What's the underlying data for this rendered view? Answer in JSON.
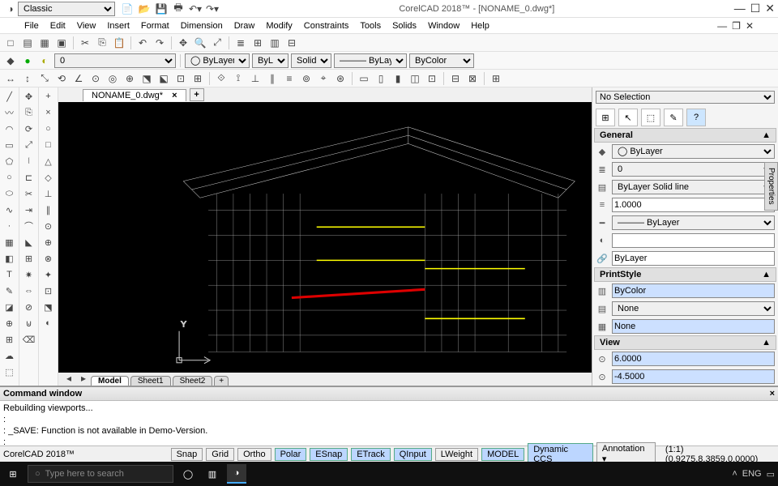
{
  "title": "CorelCAD 2018™ - [NONAME_0.dwg*]",
  "workspace": "Classic",
  "menus": [
    "File",
    "Edit",
    "View",
    "Insert",
    "Format",
    "Dimension",
    "Draw",
    "Modify",
    "Constraints",
    "Tools",
    "Solids",
    "Window",
    "Help"
  ],
  "doc_tab": "NONAME_0.dwg*",
  "view_tabs": [
    "Model",
    "Sheet1",
    "Sheet2"
  ],
  "layer_combo1": "◯ ByLayer",
  "layer_combo2": "ByLayer",
  "linetype": "Solid line",
  "layer_line": "ByLayer",
  "bycolor": "ByColor",
  "zero": "0",
  "no_selection": "No Selection",
  "sections": {
    "general": "General",
    "printstyle": "PrintStyle",
    "view": "View"
  },
  "general": {
    "layer": "◯ ByLayer",
    "zero": "0",
    "linetype": "ByLayer    Solid line",
    "scale": "1.0000",
    "lineweight": "ByLayer",
    "empty": "",
    "color": "ByLayer"
  },
  "printstyle": {
    "bycolor": "ByColor",
    "none1": "None",
    "none2": "None"
  },
  "view": {
    "val1": "6.0000",
    "val2": "-4.5000"
  },
  "cmd": {
    "title": "Command window",
    "line1": "Rebuilding viewports...",
    "line2": ":",
    "line3": ": _SAVE: Function is not available in Demo-Version.",
    "line4": ":"
  },
  "status": {
    "app": "CorelCAD 2018™",
    "buttons": [
      "Snap",
      "Grid",
      "Ortho",
      "Polar",
      "ESnap",
      "ETrack",
      "QInput",
      "LWeight",
      "MODEL",
      "Dynamic CCS"
    ],
    "active": [
      3,
      4,
      5,
      6,
      8,
      9
    ],
    "annotation": "Annotation",
    "coords": "(1:1)   (0.9275,8.3859,0.0000)"
  },
  "taskbar": {
    "search_placeholder": "Type here to search",
    "lang": "ENG"
  },
  "props_tab": "Properties"
}
